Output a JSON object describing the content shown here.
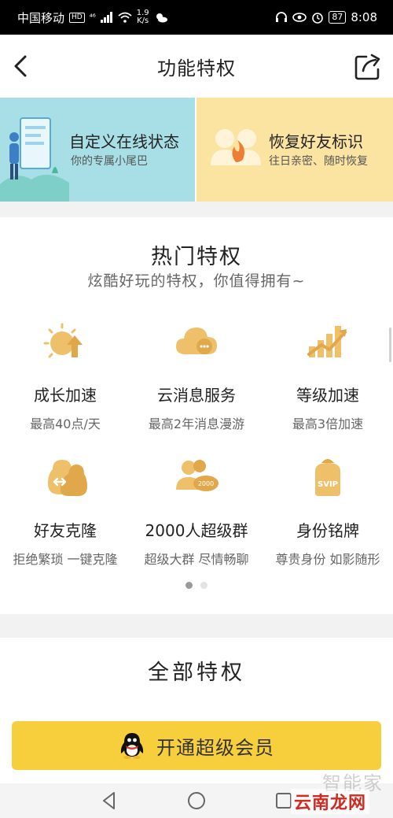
{
  "status_bar": {
    "carrier": "中国移动",
    "hd_badge": "HD",
    "network": "⁴⁶",
    "speed_value": "1.9",
    "speed_unit": "K/s",
    "battery": "87",
    "time": "8:08"
  },
  "header": {
    "title": "功能特权"
  },
  "banners": [
    {
      "title": "自定义在线状态",
      "subtitle": "你的专属小尾巴",
      "bg": "#a8dfe6"
    },
    {
      "title": "恢复好友标识",
      "subtitle": "往日亲密、随时恢复",
      "bg": "#fbe3a1"
    }
  ],
  "hot": {
    "title": "热门特权",
    "subtitle": "炫酷好玩的特权，你值得拥有~",
    "items": [
      {
        "name": "成长加速",
        "desc": "最高40点/天",
        "icon": "sun-arrow-icon"
      },
      {
        "name": "云消息服务",
        "desc": "最高2年消息漫游",
        "icon": "cloud-message-icon"
      },
      {
        "name": "等级加速",
        "desc": "最高3倍加速",
        "icon": "level-bars-icon"
      },
      {
        "name": "好友克隆",
        "desc": "拒绝繁琐 一键克隆",
        "icon": "penguin-clone-icon"
      },
      {
        "name": "2000人超级群",
        "desc": "超级大群 尽情畅聊",
        "icon": "group-2000-icon"
      },
      {
        "name": "身份铭牌",
        "desc": "尊贵身份 如影随形",
        "icon": "svip-badge-icon"
      }
    ],
    "group_badge": "2000",
    "svip_text": "SVIP",
    "page_count": 2,
    "active_page": 1
  },
  "all": {
    "title": "全部特权",
    "button_label": "开通超级会员"
  },
  "watermark": {
    "line1": "智能家",
    "line2": "云南龙网"
  },
  "colors": {
    "accent_gold": "#e8b04a",
    "button_yellow": "#f7cf3c"
  }
}
